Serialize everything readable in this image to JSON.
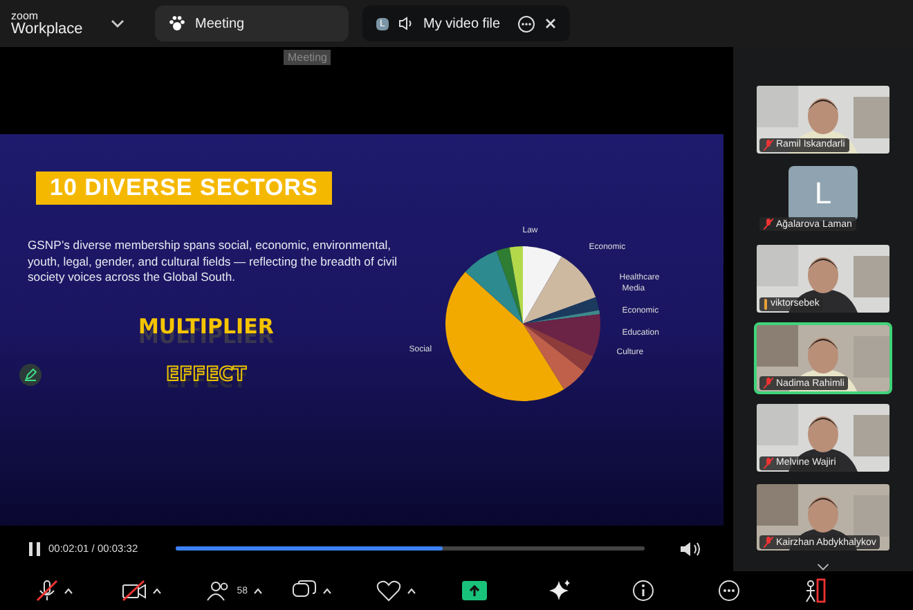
{
  "app": {
    "brand_top": "zoom",
    "brand_bottom": "Workplace"
  },
  "tabs": [
    {
      "label": "Meeting",
      "selected": false,
      "kind": "meeting"
    },
    {
      "label": "My video file",
      "selected": true,
      "kind": "file",
      "avatar": "L"
    }
  ],
  "tooltip": "Meeting",
  "slide": {
    "title": "10 DIVERSE SECTORS",
    "body": "GSNP’s diverse membership spans social, economic, environmental, youth, legal, gender, and cultural fields — reflecting the breadth of civil society voices across the Global South.",
    "headline": "MULTIPLIER",
    "subline": "EFFECT",
    "pie_labels": [
      "Law",
      "Economic",
      "Healthcare",
      "Media",
      "Economic",
      "Education",
      "Culture",
      "Social"
    ]
  },
  "player": {
    "time": "00:02:01 / 00:03:32",
    "level": 0.57,
    "playing": true
  },
  "participants": [
    {
      "name": "Ramil Iskandarli",
      "kind": "video",
      "muted": true,
      "speaking": false
    },
    {
      "name": "Ağalarova Laman",
      "kind": "avatar",
      "initial": "L",
      "muted": true,
      "speaking": false
    },
    {
      "name": "viktorsebek",
      "kind": "video",
      "muted": false,
      "speaking": false
    },
    {
      "name": "Nadima Rahimli",
      "kind": "video",
      "muted": true,
      "speaking": true
    },
    {
      "name": "Melvine Wajiri",
      "kind": "video",
      "muted": true,
      "speaking": false
    },
    {
      "name": "Kairzhan Abdykhalykov",
      "kind": "video",
      "muted": true,
      "speaking": false
    }
  ],
  "toolbar": [
    {
      "kind": "audio",
      "off": true,
      "caret": true
    },
    {
      "kind": "video",
      "off": true,
      "caret": true
    },
    {
      "kind": "participants",
      "count": "58",
      "caret": true
    },
    {
      "kind": "chat",
      "caret": true
    },
    {
      "kind": "react",
      "caret": true
    },
    {
      "kind": "share"
    },
    {
      "kind": "ai"
    },
    {
      "kind": "info"
    },
    {
      "kind": "more"
    },
    {
      "kind": "leave"
    }
  ]
}
